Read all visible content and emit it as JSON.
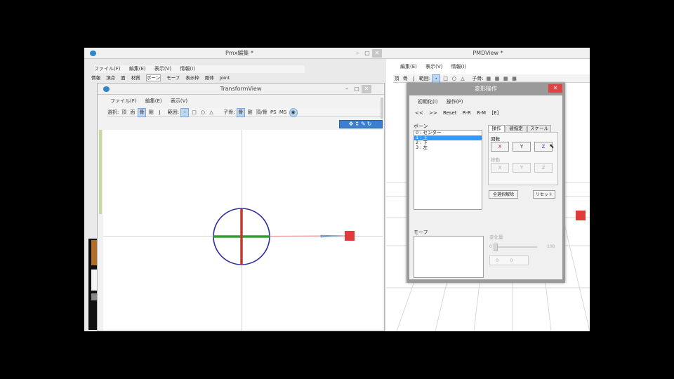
{
  "pmx_window": {
    "title": "Pmx編集 *",
    "menu": [
      "ファイル(F)",
      "編集(E)",
      "表示(V)",
      "情報(I)"
    ],
    "tabs": [
      "情報",
      "頂点",
      "面",
      "材質",
      "ボーン",
      "モーフ",
      "表示枠",
      "剛体",
      "Joint"
    ]
  },
  "transform_view": {
    "title": "TransformView",
    "menu": [
      "ファイル(F)",
      "編集(E)",
      "表示(V)"
    ],
    "toolbar": {
      "select_label": "選択:",
      "select_items": [
        "頂",
        "面",
        "骨",
        "剛",
        "J"
      ],
      "range_label": "範囲:",
      "range_items": [
        "・",
        "□",
        "○",
        "△"
      ],
      "sub_label": "子骨:",
      "sub_items": [
        "骨",
        "剛",
        "頂/骨",
        "PS",
        "MS"
      ]
    }
  },
  "pmd_view": {
    "title": "PMDView *",
    "menu": [
      "編集(E)",
      "表示(V)",
      "情報(I)"
    ],
    "toolbar": {
      "select_items": [
        "頂",
        "骨",
        "J"
      ],
      "range_label": "範囲:",
      "range_items": [
        "・",
        "□",
        "○",
        "△"
      ],
      "sub_label": "子骨:"
    }
  },
  "transform_dialog": {
    "title": "変形操作",
    "menu": [
      "初期化(I)",
      "操作(P)"
    ],
    "toolbar": [
      "<<",
      ">>",
      "Reset",
      "R-R",
      "R-M",
      "[E]"
    ],
    "bone_section": "ボーン",
    "bones": [
      "0 : センター",
      "1 : 上",
      "2 : 下",
      "3 : 左"
    ],
    "selected_bone_index": 1,
    "tabs": [
      "操作",
      "値指定",
      "スケール"
    ],
    "rotate_label": "回転",
    "rotate_buttons": [
      "X",
      "Y",
      "Z"
    ],
    "move_label": "移動",
    "move_buttons": [
      "X",
      "Y",
      "Z"
    ],
    "release_button": "全選択解除",
    "reset_button": "リセット",
    "morph_section": "モーフ",
    "morph_value_label": "変化量",
    "slider_min": "0",
    "slider_max": "100",
    "value_field": "0",
    "value_field_unit": "0"
  },
  "colors": {
    "x_axis": "#2fa02f",
    "y_axis": "#c0392b",
    "ring": "#2b2ba0",
    "handle": "#e03a3a",
    "close_button": "#e04343",
    "selection": "#3399ff"
  }
}
